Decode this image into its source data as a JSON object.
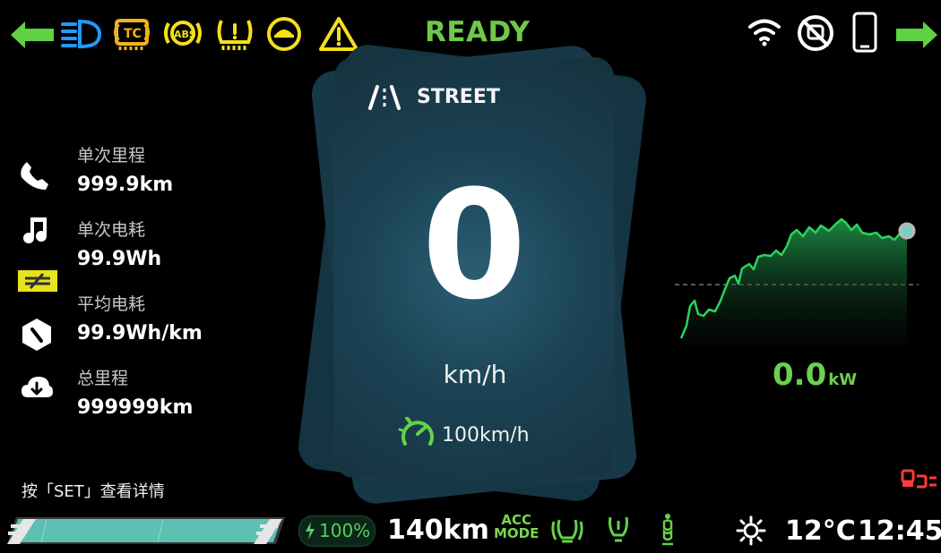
{
  "status": {
    "ready_text": "READY"
  },
  "drive_mode": {
    "label": "STREET"
  },
  "speedometer": {
    "speed": "0",
    "unit": "km/h",
    "speed_limit": "100km/h"
  },
  "trip_stats": [
    {
      "label": "单次里程",
      "value": "999.9km",
      "icon": "phone-icon"
    },
    {
      "label": "单次电耗",
      "value": "99.9Wh",
      "icon": "music-note-icon"
    },
    {
      "label": "平均电耗",
      "value": "99.9Wh/km",
      "icon": "navigation-diamond-icon"
    },
    {
      "label": "总里程",
      "value": "999999km",
      "icon": "download-cloud-icon"
    }
  ],
  "hint": {
    "text": "按「SET」查看详情"
  },
  "power": {
    "value": "0.0",
    "unit": "kW"
  },
  "battery": {
    "percent_text": "100%",
    "level": 1.0
  },
  "range": {
    "value": "140km"
  },
  "acc": {
    "line1": "ACC",
    "line2": "MODE"
  },
  "environment": {
    "temperature": "12°C",
    "time": "12:45"
  },
  "colors": {
    "green": "#63d24a",
    "amber": "#f1b31c",
    "blue": "#1c98ff",
    "yellow": "#f5df1b",
    "red": "#ff3b3b"
  },
  "icons": {
    "top_left": [
      "left-turn-signal-icon",
      "headlight-icon",
      "traction-control-icon",
      "abs-icon",
      "tire-pressure-icon",
      "eco-turtle-icon",
      "warning-triangle-icon"
    ],
    "top_right": [
      "wifi-icon",
      "camera-off-icon",
      "phone-device-icon",
      "right-turn-signal-icon"
    ],
    "bottom_status": [
      "battery-bolt-icon",
      "steering-seat-icon",
      "seat-heater-icon",
      "driver-seat-icon",
      "sun-icon",
      "charge-plug-icon"
    ]
  }
}
